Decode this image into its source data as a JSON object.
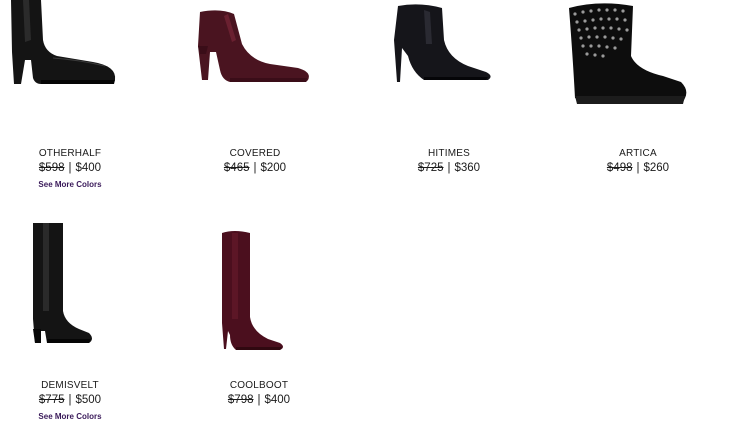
{
  "products": [
    {
      "name": "OTHERHALF",
      "original_price": "$598",
      "sale_price": "$400",
      "separator": "|",
      "see_more": "See More Colors",
      "color": "#111111",
      "icon": "black-heeled-ankle-boot-image"
    },
    {
      "name": "COVERED",
      "original_price": "$465",
      "sale_price": "$200",
      "separator": "|",
      "see_more": "",
      "color": "#4a1420",
      "icon": "burgundy-heeled-bootie-image"
    },
    {
      "name": "HITIMES",
      "original_price": "$725",
      "sale_price": "$360",
      "separator": "|",
      "see_more": "",
      "color": "#15151a",
      "icon": "black-stiletto-bootie-image"
    },
    {
      "name": "ARTICA",
      "original_price": "$498",
      "sale_price": "$260",
      "separator": "|",
      "see_more": "",
      "color": "#0d0d0d",
      "icon": "black-studded-boot-image"
    },
    {
      "name": "DEMISVELT",
      "original_price": "$775",
      "sale_price": "$500",
      "separator": "|",
      "see_more": "See More Colors",
      "color": "#141414",
      "icon": "black-knee-boot-image"
    },
    {
      "name": "COOLBOOT",
      "original_price": "$798",
      "sale_price": "$400",
      "separator": "|",
      "see_more": "",
      "color": "#4b0f1e",
      "icon": "burgundy-knee-boot-image"
    }
  ],
  "colors": {
    "text": "#1a1a1a",
    "see_more": "#3a1a5a",
    "background": "#ffffff"
  }
}
